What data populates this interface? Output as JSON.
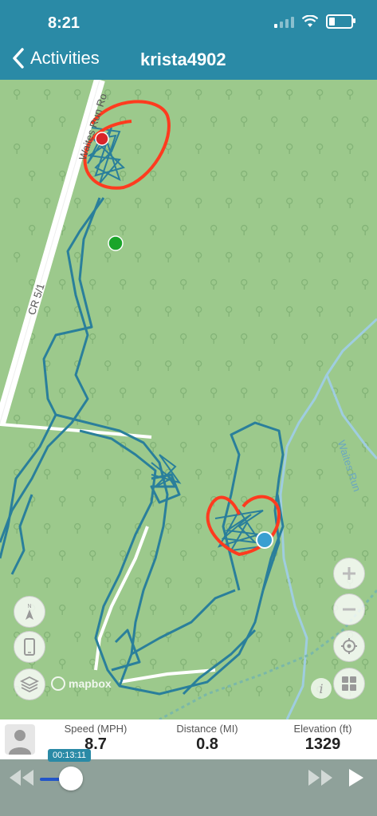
{
  "status_bar": {
    "time": "8:21"
  },
  "header": {
    "back_label": "Activities",
    "title": "krista4902"
  },
  "map": {
    "road_labels": [
      "Waites Run Ro",
      "CR 5/1",
      "Waites Run"
    ],
    "attribution": "mapbox",
    "controls": [
      "zoom-in",
      "zoom-out",
      "locate",
      "layers-grid",
      "compass",
      "phone",
      "layers-stack",
      "info"
    ]
  },
  "stats": {
    "speed": {
      "label": "Speed (MPH)",
      "value": "8.7"
    },
    "distance": {
      "label": "Distance (MI)",
      "value": "0.8"
    },
    "elevation": {
      "label": "Elevation (ft)",
      "value": "1329"
    }
  },
  "player": {
    "elapsed": "00:13:11",
    "progress": 0.04
  },
  "colors": {
    "header": "#2a8aa6",
    "map_bg": "#9cc98c",
    "track": "#2a7f9b",
    "annotation": "#ff3b1f",
    "start_marker": "#1aa52a",
    "end_marker": "#d8242a"
  }
}
